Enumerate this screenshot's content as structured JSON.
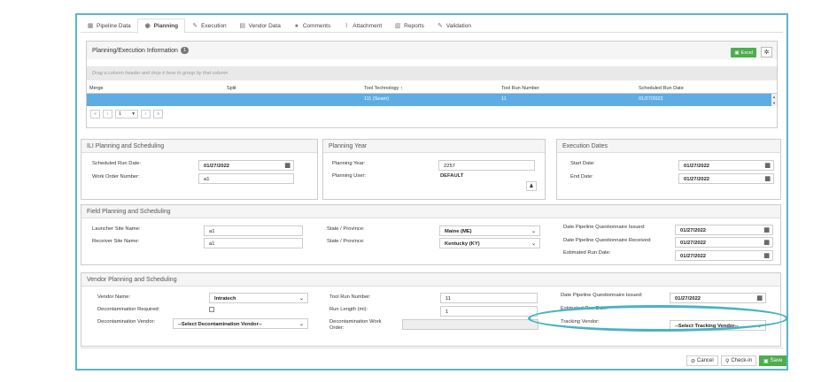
{
  "tabs": [
    {
      "label": "Pipeline Data",
      "icon": "grid-icon"
    },
    {
      "label": "Planning",
      "icon": "eye-icon",
      "active": true
    },
    {
      "label": "Execution",
      "icon": "pencil-icon"
    },
    {
      "label": "Vendor Data",
      "icon": "table-icon"
    },
    {
      "label": "Comments",
      "icon": "comment-icon"
    },
    {
      "label": "Attachment",
      "icon": "paperclip-icon"
    },
    {
      "label": "Reports",
      "icon": "bar-chart-icon"
    },
    {
      "label": "Validation",
      "icon": "edit-icon"
    }
  ],
  "planning_exec": {
    "title": "Planning/Execution Information",
    "badge": "1",
    "excel_label": "Excel",
    "group_hint": "Drag a column header and drop it here to group by that column",
    "columns": [
      "Merge",
      "Split",
      "Tool Technology",
      "Tool Run Number",
      "Scheduled Run Date"
    ],
    "sort_indicator": "↑",
    "rows": [
      [
        "",
        "",
        "111 (Seam)",
        "11",
        "01/27/2022"
      ]
    ],
    "pager": {
      "first": "«",
      "prev": "‹",
      "page": "1",
      "next": "›",
      "last": "»"
    }
  },
  "ili": {
    "title": "ILI Planning and Scheduling",
    "scheduled_run_date_label": "Scheduled Run Date:",
    "scheduled_run_date": "01/27/2022",
    "work_order_label": "Work Order Number:",
    "work_order": "a1"
  },
  "planning_year": {
    "title": "Planning Year",
    "year_label": "Planning Year:",
    "year": "2257",
    "user_label": "Planning User:",
    "user": "DEFAULT"
  },
  "execution_dates": {
    "title": "Execution Dates",
    "start_label": "Start Date:",
    "start": "01/27/2022",
    "end_label": "End Date:",
    "end": "01/27/2022"
  },
  "field": {
    "title": "Field Planning and Scheduling",
    "launcher_label": "Launcher Site Name:",
    "launcher": "a1",
    "receiver_label": "Receiver Site Name:",
    "receiver": "a1",
    "state1_label": "State / Province:",
    "state1": "Maine (ME)",
    "state2_label": "State / Province:",
    "state2": "Kentucky (KY)",
    "dpq_issued_label": "Date Pipeline Questionnaire Issued:",
    "dpq_issued": "01/27/2022",
    "dpq_received_label": "Date Pipeline Questionnaire Received:",
    "dpq_received": "01/27/2022",
    "est_run_label": "Estimated Run Date:",
    "est_run": "01/27/2022"
  },
  "vendor": {
    "title": "Vendor Planning and Scheduling",
    "vendor_name_label": "Vendor Name:",
    "vendor_name": "Intratech",
    "decon_req_label": "Decontamination Required:",
    "decon_vendor_label": "Decontamination Vendor:",
    "decon_vendor": "--Select Decontamination Vendor--",
    "tool_run_label": "Tool Run Number:",
    "tool_run": "11",
    "run_length_label": "Run Length (mi):",
    "run_length": "1",
    "decon_wo_label": "Decontamination Work Order:",
    "dpq_issued_label": "Date Pipeline Questionnaire Issued:",
    "dpq_issued": "01/27/2022",
    "est_run_label": "Estimated Run Date:",
    "tracking_label": "Tracking Vendor:",
    "tracking": "--Select Tracking Vendor--"
  },
  "footer": {
    "cancel": "Cancel",
    "checkin": "Check-in",
    "save": "Save"
  },
  "colors": {
    "accent": "#49b3c2",
    "selected_row": "#5dade2",
    "save_green": "#4cae4c"
  }
}
